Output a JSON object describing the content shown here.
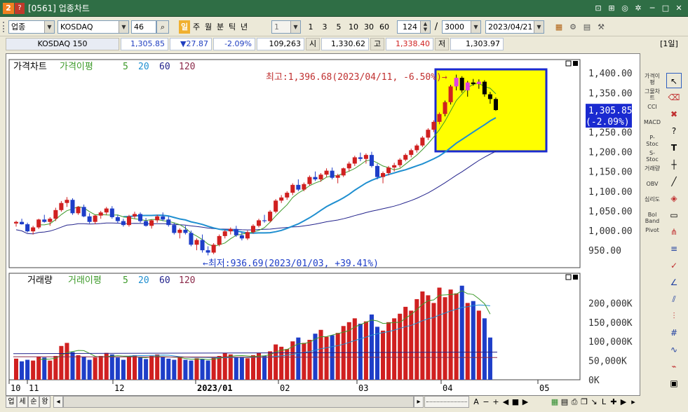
{
  "window": {
    "title": "[0561] 업종차트"
  },
  "toolbar": {
    "market": "업종",
    "index_name": "KOSDAQ",
    "code": "46",
    "periods": [
      "일",
      "주",
      "월",
      "분",
      "틱",
      "년"
    ],
    "active_period": "일",
    "multiplier": "1",
    "intervals": [
      "1",
      "3",
      "5",
      "10",
      "30",
      "60"
    ],
    "count": "124",
    "slash": "/",
    "max_count": "3000",
    "date": "2023/04/21"
  },
  "quote": {
    "name": "KOSDAQ 150",
    "price": "1,305.85",
    "change": "▼27.87",
    "change_pct": "-2.09%",
    "volume": "109,263",
    "open_label": "시",
    "open": "1,330.62",
    "high_label": "고",
    "high": "1,338.40",
    "low_label": "저",
    "low": "1,303.97",
    "period_tag": "[1일]"
  },
  "price_panel": {
    "label": "가격차트",
    "ma_label": "가격이평",
    "ma_periods": [
      "5",
      "20",
      "60",
      "120"
    ],
    "ma_colors": [
      "#3d9a2a",
      "#1f8fd0",
      "#23238c",
      "#8b2a4a"
    ],
    "up_color": "#d02020",
    "down_color": "#1e3ec8",
    "high_annotation": "최고:1,396.68(2023/04/11, -6.50%)→",
    "low_annotation": "←최저:936.69(2023/01/03, +39.41%)",
    "y_ticks": [
      "1,400.00",
      "1,350.00",
      "1,300.00",
      "1,250.00",
      "1,200.00",
      "1,150.00",
      "1,100.00",
      "1,050.00",
      "1,000.00",
      "950.00"
    ],
    "last_price": "1,305.85",
    "last_change": "(-2.09%)"
  },
  "volume_panel": {
    "label": "거래량",
    "ma_label": "거래이평",
    "ma_periods": [
      "5",
      "20",
      "60",
      "120"
    ],
    "y_ticks": [
      "200,000K",
      "150,000K",
      "100,000K",
      "50,000K",
      "0K"
    ]
  },
  "x_axis": {
    "labels": [
      "10",
      "11",
      "12",
      "2023/01",
      "02",
      "03",
      "04",
      "05"
    ]
  },
  "left_tools": [
    "가격이평",
    "그물차트",
    "CCI",
    "MACD",
    "P-Stoc",
    "S-Stoc",
    "거래량",
    "OBV",
    "심리도",
    "Bol Band",
    "Pivot"
  ],
  "bottom": {
    "tabs": [
      "업",
      "세",
      "순",
      "왕"
    ]
  },
  "chart_data": {
    "type": "candlestick",
    "series_price": [
      [
        1018,
        1025,
        1010,
        1022
      ],
      [
        1022,
        1030,
        1015,
        1016
      ],
      [
        1016,
        1020,
        995,
        998
      ],
      [
        998,
        1012,
        990,
        1008
      ],
      [
        1008,
        1030,
        1004,
        1028
      ],
      [
        1028,
        1040,
        1020,
        1022
      ],
      [
        1022,
        1034,
        1012,
        1030
      ],
      [
        1030,
        1058,
        1024,
        1052
      ],
      [
        1052,
        1075,
        1048,
        1070
      ],
      [
        1070,
        1085,
        1060,
        1078
      ],
      [
        1078,
        1082,
        1040,
        1044
      ],
      [
        1044,
        1062,
        1040,
        1060
      ],
      [
        1060,
        1066,
        1034,
        1036
      ],
      [
        1036,
        1044,
        1018,
        1022
      ],
      [
        1022,
        1040,
        1016,
        1038
      ],
      [
        1038,
        1050,
        1030,
        1046
      ],
      [
        1046,
        1060,
        1040,
        1056
      ],
      [
        1056,
        1062,
        1030,
        1034
      ],
      [
        1034,
        1040,
        1018,
        1024
      ],
      [
        1024,
        1030,
        1010,
        1014
      ],
      [
        1014,
        1040,
        1010,
        1036
      ],
      [
        1036,
        1048,
        1030,
        1042
      ],
      [
        1042,
        1046,
        1020,
        1024
      ],
      [
        1024,
        1032,
        1010,
        1012
      ],
      [
        1012,
        1028,
        1005,
        1026
      ],
      [
        1026,
        1040,
        1020,
        1036
      ],
      [
        1036,
        1046,
        1024,
        1028
      ],
      [
        1028,
        1036,
        1010,
        1014
      ],
      [
        1014,
        1020,
        990,
        994
      ],
      [
        994,
        1006,
        980,
        1002
      ],
      [
        1002,
        1012,
        990,
        994
      ],
      [
        994,
        1000,
        960,
        964
      ],
      [
        964,
        980,
        950,
        976
      ],
      [
        976,
        990,
        944,
        950
      ],
      [
        950,
        960,
        937,
        944
      ],
      [
        944,
        968,
        940,
        964
      ],
      [
        964,
        990,
        960,
        986
      ],
      [
        986,
        1002,
        980,
        998
      ],
      [
        998,
        1008,
        990,
        1004
      ],
      [
        1004,
        1012,
        984,
        988
      ],
      [
        988,
        996,
        975,
        980
      ],
      [
        980,
        1000,
        976,
        996
      ],
      [
        996,
        1016,
        992,
        1012
      ],
      [
        1012,
        1030,
        1008,
        1026
      ],
      [
        1026,
        1040,
        1020,
        1024
      ],
      [
        1024,
        1052,
        1020,
        1048
      ],
      [
        1048,
        1080,
        1044,
        1076
      ],
      [
        1076,
        1090,
        1070,
        1084
      ],
      [
        1084,
        1100,
        1078,
        1096
      ],
      [
        1096,
        1120,
        1090,
        1116
      ],
      [
        1116,
        1130,
        1100,
        1104
      ],
      [
        1104,
        1122,
        1100,
        1118
      ],
      [
        1118,
        1140,
        1114,
        1136
      ],
      [
        1136,
        1150,
        1126,
        1130
      ],
      [
        1130,
        1146,
        1124,
        1142
      ],
      [
        1142,
        1158,
        1136,
        1152
      ],
      [
        1152,
        1160,
        1130,
        1134
      ],
      [
        1134,
        1144,
        1120,
        1140
      ],
      [
        1140,
        1160,
        1136,
        1158
      ],
      [
        1158,
        1175,
        1150,
        1170
      ],
      [
        1170,
        1190,
        1164,
        1186
      ],
      [
        1186,
        1198,
        1176,
        1182
      ],
      [
        1182,
        1196,
        1170,
        1192
      ],
      [
        1192,
        1200,
        1160,
        1164
      ],
      [
        1164,
        1170,
        1130,
        1136
      ],
      [
        1136,
        1150,
        1120,
        1146
      ],
      [
        1146,
        1164,
        1140,
        1160
      ],
      [
        1160,
        1172,
        1150,
        1166
      ],
      [
        1166,
        1184,
        1160,
        1180
      ],
      [
        1180,
        1196,
        1176,
        1192
      ],
      [
        1192,
        1208,
        1186,
        1204
      ],
      [
        1204,
        1220,
        1198,
        1216
      ],
      [
        1216,
        1240,
        1212,
        1236
      ],
      [
        1236,
        1260,
        1230,
        1256
      ],
      [
        1256,
        1280,
        1250,
        1276
      ],
      [
        1276,
        1300,
        1270,
        1296
      ],
      [
        1296,
        1330,
        1290,
        1326
      ],
      [
        1326,
        1370,
        1320,
        1366
      ],
      [
        1366,
        1396,
        1356,
        1388
      ],
      [
        1388,
        1392,
        1350,
        1356
      ],
      [
        1356,
        1380,
        1340,
        1376
      ],
      [
        1376,
        1385,
        1368,
        1372
      ],
      [
        1372,
        1384,
        1360,
        1378
      ],
      [
        1378,
        1382,
        1340,
        1346
      ],
      [
        1346,
        1352,
        1322,
        1334
      ],
      [
        1334,
        1338,
        1304,
        1306
      ]
    ],
    "series_volume": [
      55,
      48,
      52,
      50,
      60,
      58,
      50,
      62,
      88,
      96,
      72,
      64,
      60,
      52,
      58,
      62,
      70,
      66,
      58,
      52,
      60,
      64,
      58,
      54,
      62,
      66,
      60,
      55,
      52,
      58,
      52,
      50,
      56,
      54,
      50,
      58,
      62,
      70,
      66,
      58,
      60,
      56,
      64,
      70,
      62,
      74,
      92,
      86,
      80,
      100,
      110,
      96,
      104,
      120,
      130,
      112,
      116,
      122,
      140,
      150,
      160,
      146,
      152,
      170,
      138,
      128,
      150,
      160,
      172,
      190,
      180,
      210,
      230,
      220,
      200,
      240,
      215,
      235,
      225,
      245,
      200,
      205,
      180,
      160,
      110
    ],
    "x_labels": [
      "10",
      "11",
      "12",
      "2023/01",
      "02",
      "03",
      "04",
      "05"
    ],
    "ylim_price": [
      920,
      1420
    ],
    "ylim_volume": [
      0,
      250000
    ],
    "volume_unit": "K"
  }
}
